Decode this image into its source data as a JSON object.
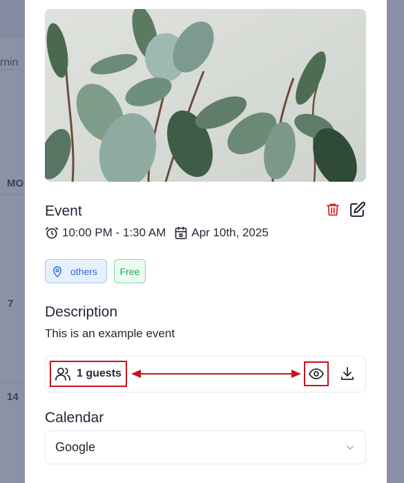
{
  "background": {
    "partial_text": "rnin",
    "day_header": "MO",
    "day_numbers": [
      "7",
      "14"
    ]
  },
  "event": {
    "title": "Event",
    "time_range": "10:00 PM - 1:30 AM",
    "date": "Apr 10th, 2025",
    "tags": {
      "location": "others",
      "price": "Free"
    },
    "description_heading": "Description",
    "description": "This is an example event",
    "guests_label": "1 guests",
    "calendar_heading": "Calendar",
    "calendar_value": "Google"
  },
  "icons": [
    "alarm-clock-icon",
    "calendar-icon",
    "map-pin-icon",
    "trash-icon",
    "edit-icon",
    "users-icon",
    "eye-icon",
    "download-icon",
    "chevron-down-icon"
  ],
  "colors": {
    "accent_red": "#c8111a",
    "delete_red": "#dc2626",
    "location_blue": "#2a6fd3",
    "free_green": "#1ea459",
    "annotation_red": "#c8111a"
  }
}
